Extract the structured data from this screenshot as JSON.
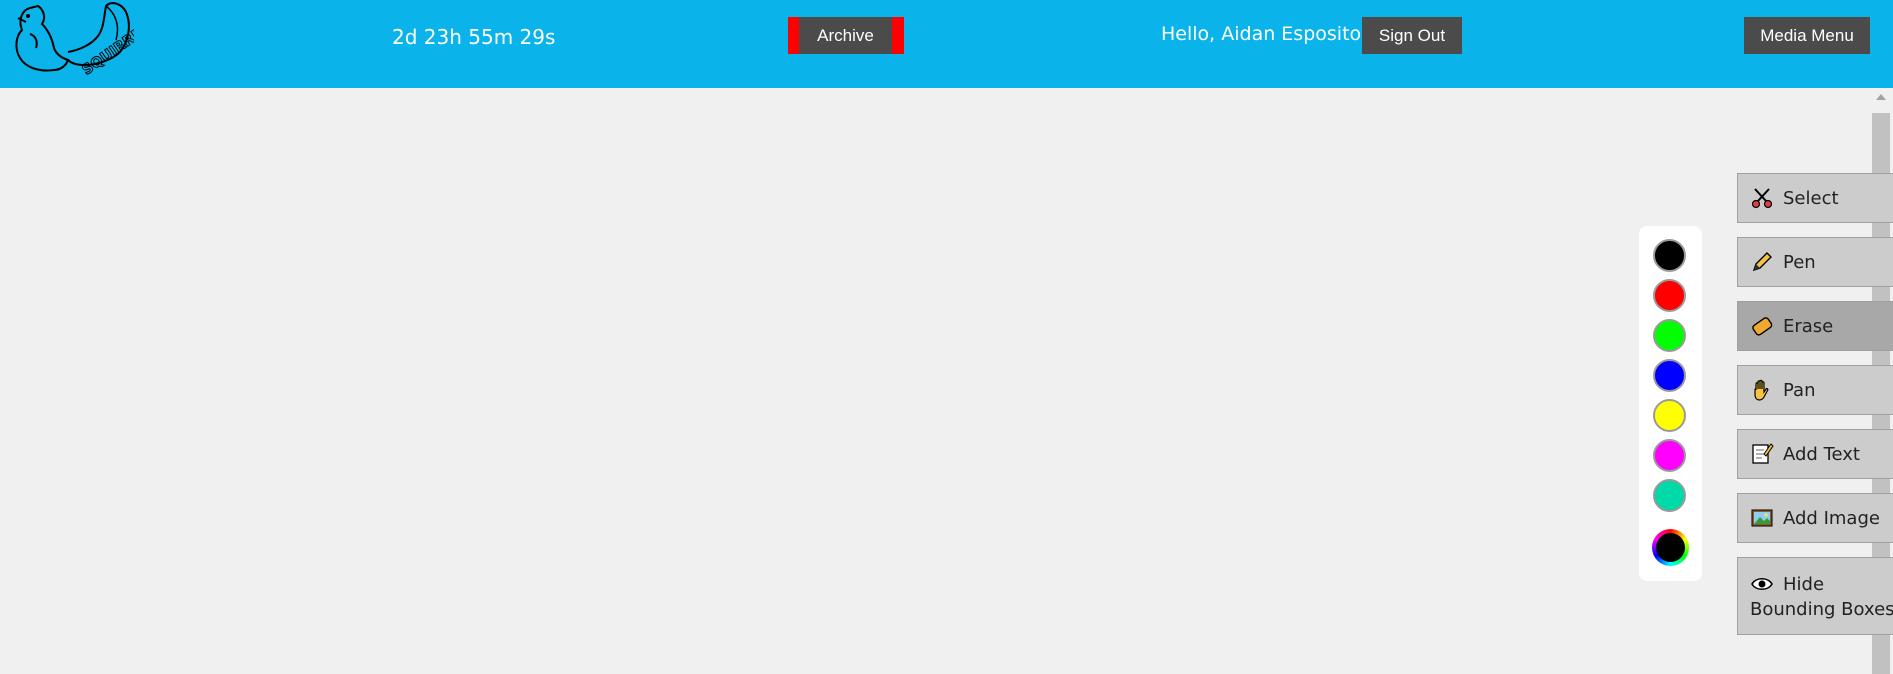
{
  "header": {
    "timer": "2d 23h 55m 29s",
    "archive_label": "Archive",
    "greeting": "Hello, Aidan Esposito",
    "signout_label": "Sign Out",
    "media_menu_label": "Media Menu",
    "logo_text": "SQUIRREL",
    "bg_color": "#0ab4eb"
  },
  "palette": {
    "colors": [
      "#000000",
      "#ff0000",
      "#00ff00",
      "#0000ff",
      "#ffff00",
      "#ff00ff",
      "#00d9a8"
    ],
    "custom_color": "#000000"
  },
  "tools": [
    {
      "label": "Select",
      "icon": "scissors-icon"
    },
    {
      "label": "Pen",
      "icon": "pencil-icon"
    },
    {
      "label": "Erase",
      "icon": "eraser-icon",
      "active": true
    },
    {
      "label": "Pan",
      "icon": "hand-icon"
    },
    {
      "label": "Add Text",
      "icon": "note-icon"
    },
    {
      "label": "Add Image",
      "icon": "picture-icon"
    },
    {
      "label_line1": "Hide",
      "label_line2": "Bounding Boxes",
      "icon": "eye-icon"
    }
  ]
}
